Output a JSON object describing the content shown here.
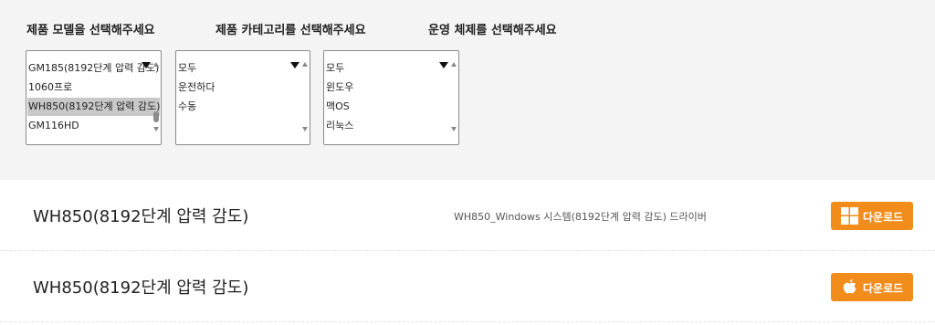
{
  "filters": {
    "model_label": "제품 모델을 선택해주세요",
    "category_label": "제품 카테고리를 선택해주세요",
    "os_label": "운영 체제를 선택해주세요",
    "model_options": [
      "GM185(8192단계 압력 감도)",
      "1060프로",
      "WH850(8192단계 압력 감도)",
      "GM116HD"
    ],
    "model_selected": "WH850(8192단계 압력 감도)",
    "category_options": [
      "모두",
      "운전하다",
      "수동"
    ],
    "os_options": [
      "모두",
      "윈도우",
      "맥OS",
      "리눅스"
    ]
  },
  "results": [
    {
      "title": "WH850(8192단계 압력 감도)",
      "description": "WH850_Windows 시스템(8192단계 압력 감도) 드라이버",
      "icon": "windows-icon",
      "button_label": "다운로드"
    },
    {
      "title": "WH850(8192단계 압력 감도)",
      "description": "",
      "icon": "apple-icon",
      "button_label": "다운로드"
    }
  ],
  "colors": {
    "accent": "#f28c1b",
    "filter_background": "#f4f4f5",
    "selected_option": "#c8c8c8"
  }
}
